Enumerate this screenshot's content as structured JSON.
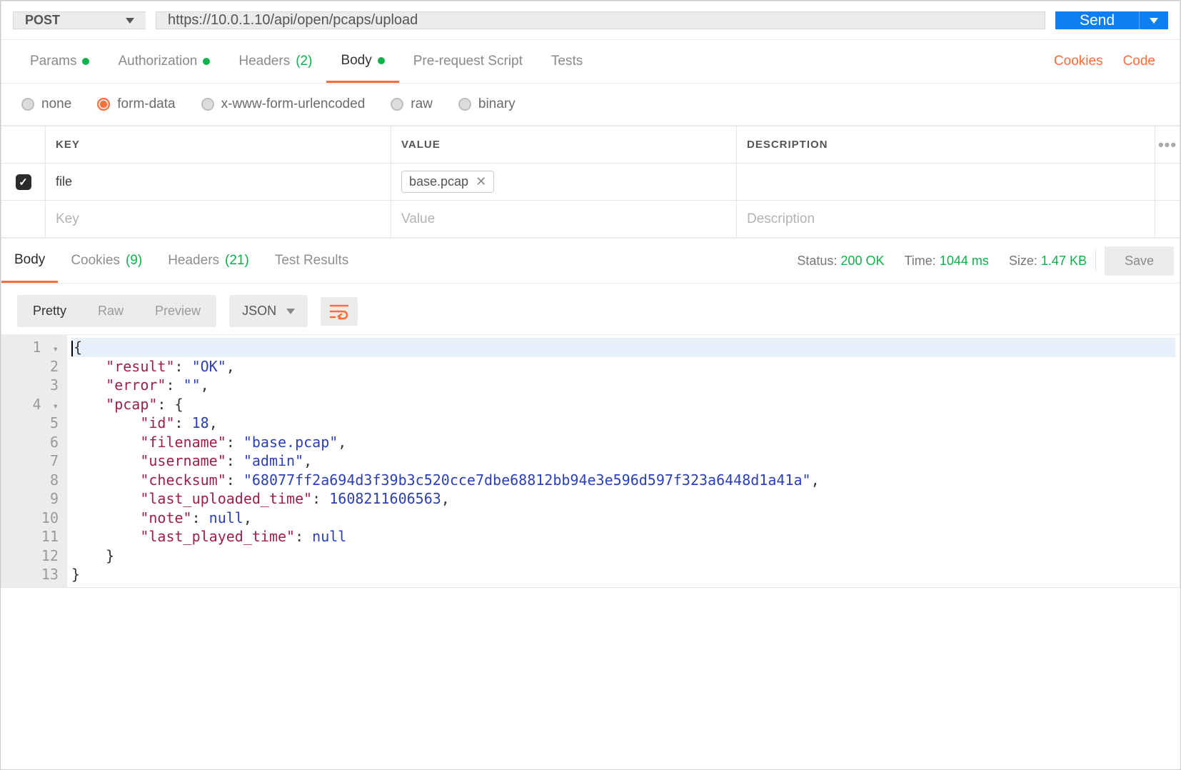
{
  "request": {
    "method": "POST",
    "url": "https://10.0.1.10/api/open/pcaps/upload",
    "send_label": "Send"
  },
  "tabs": {
    "params": {
      "label": "Params",
      "dot": true
    },
    "authorization": {
      "label": "Authorization",
      "dot": true
    },
    "headers": {
      "label": "Headers",
      "count": "(2)"
    },
    "body": {
      "label": "Body",
      "dot": true,
      "active": true
    },
    "prerequest": {
      "label": "Pre-request Script"
    },
    "tests": {
      "label": "Tests"
    },
    "cookies_link": "Cookies",
    "code_link": "Code"
  },
  "body_types": {
    "none": "none",
    "form": "form-data",
    "urlenc": "x-www-form-urlencoded",
    "raw": "raw",
    "binary": "binary",
    "selected": "form-data"
  },
  "formdata": {
    "headers": {
      "key": "KEY",
      "value": "VALUE",
      "desc": "DESCRIPTION"
    },
    "rows": [
      {
        "enabled": true,
        "key": "file",
        "file": "base.pcap"
      }
    ],
    "placeholders": {
      "key": "Key",
      "value": "Value",
      "desc": "Description"
    }
  },
  "response": {
    "tabs": {
      "body": {
        "label": "Body",
        "active": true
      },
      "cookies": {
        "label": "Cookies",
        "count": "(9)"
      },
      "headers": {
        "label": "Headers",
        "count": "(21)"
      },
      "tests": {
        "label": "Test Results"
      }
    },
    "status_label": "Status:",
    "status_value": "200 OK",
    "time_label": "Time:",
    "time_value": "1044 ms",
    "size_label": "Size:",
    "size_value": "1.47 KB",
    "save_label": "Save"
  },
  "view": {
    "pretty": "Pretty",
    "raw": "Raw",
    "preview": "Preview",
    "format": "JSON"
  },
  "response_body": {
    "result": "OK",
    "error": "",
    "pcap": {
      "id": 18,
      "filename": "base.pcap",
      "username": "admin",
      "checksum": "68077ff2a694d3f39b3c520cce7dbe68812bb94e3e596d597f323a6448d1a41a",
      "last_uploaded_time": 1608211606563,
      "note": null,
      "last_played_time": null
    }
  },
  "code_lines": [
    {
      "n": "1",
      "fold": true,
      "indent": 0,
      "tokens": [
        {
          "t": "p",
          "v": "{"
        }
      ]
    },
    {
      "n": "2",
      "indent": 1,
      "tokens": [
        {
          "t": "k",
          "v": "\"result\""
        },
        {
          "t": "p",
          "v": ": "
        },
        {
          "t": "s",
          "v": "\"OK\""
        },
        {
          "t": "p",
          "v": ","
        }
      ]
    },
    {
      "n": "3",
      "indent": 1,
      "tokens": [
        {
          "t": "k",
          "v": "\"error\""
        },
        {
          "t": "p",
          "v": ": "
        },
        {
          "t": "s",
          "v": "\"\""
        },
        {
          "t": "p",
          "v": ","
        }
      ]
    },
    {
      "n": "4",
      "fold": true,
      "indent": 1,
      "tokens": [
        {
          "t": "k",
          "v": "\"pcap\""
        },
        {
          "t": "p",
          "v": ": {"
        }
      ]
    },
    {
      "n": "5",
      "indent": 2,
      "tokens": [
        {
          "t": "k",
          "v": "\"id\""
        },
        {
          "t": "p",
          "v": ": "
        },
        {
          "t": "n",
          "v": "18"
        },
        {
          "t": "p",
          "v": ","
        }
      ]
    },
    {
      "n": "6",
      "indent": 2,
      "tokens": [
        {
          "t": "k",
          "v": "\"filename\""
        },
        {
          "t": "p",
          "v": ": "
        },
        {
          "t": "s",
          "v": "\"base.pcap\""
        },
        {
          "t": "p",
          "v": ","
        }
      ]
    },
    {
      "n": "7",
      "indent": 2,
      "tokens": [
        {
          "t": "k",
          "v": "\"username\""
        },
        {
          "t": "p",
          "v": ": "
        },
        {
          "t": "s",
          "v": "\"admin\""
        },
        {
          "t": "p",
          "v": ","
        }
      ]
    },
    {
      "n": "8",
      "indent": 2,
      "tokens": [
        {
          "t": "k",
          "v": "\"checksum\""
        },
        {
          "t": "p",
          "v": ": "
        },
        {
          "t": "s",
          "v": "\"68077ff2a694d3f39b3c520cce7dbe68812bb94e3e596d597f323a6448d1a41a\""
        },
        {
          "t": "p",
          "v": ","
        }
      ]
    },
    {
      "n": "9",
      "indent": 2,
      "tokens": [
        {
          "t": "k",
          "v": "\"last_uploaded_time\""
        },
        {
          "t": "p",
          "v": ": "
        },
        {
          "t": "n",
          "v": "1608211606563"
        },
        {
          "t": "p",
          "v": ","
        }
      ]
    },
    {
      "n": "10",
      "indent": 2,
      "tokens": [
        {
          "t": "k",
          "v": "\"note\""
        },
        {
          "t": "p",
          "v": ": "
        },
        {
          "t": "nl",
          "v": "null"
        },
        {
          "t": "p",
          "v": ","
        }
      ]
    },
    {
      "n": "11",
      "indent": 2,
      "tokens": [
        {
          "t": "k",
          "v": "\"last_played_time\""
        },
        {
          "t": "p",
          "v": ": "
        },
        {
          "t": "nl",
          "v": "null"
        }
      ]
    },
    {
      "n": "12",
      "indent": 1,
      "tokens": [
        {
          "t": "p",
          "v": "}"
        }
      ]
    },
    {
      "n": "13",
      "indent": 0,
      "tokens": [
        {
          "t": "p",
          "v": "}"
        }
      ]
    }
  ]
}
